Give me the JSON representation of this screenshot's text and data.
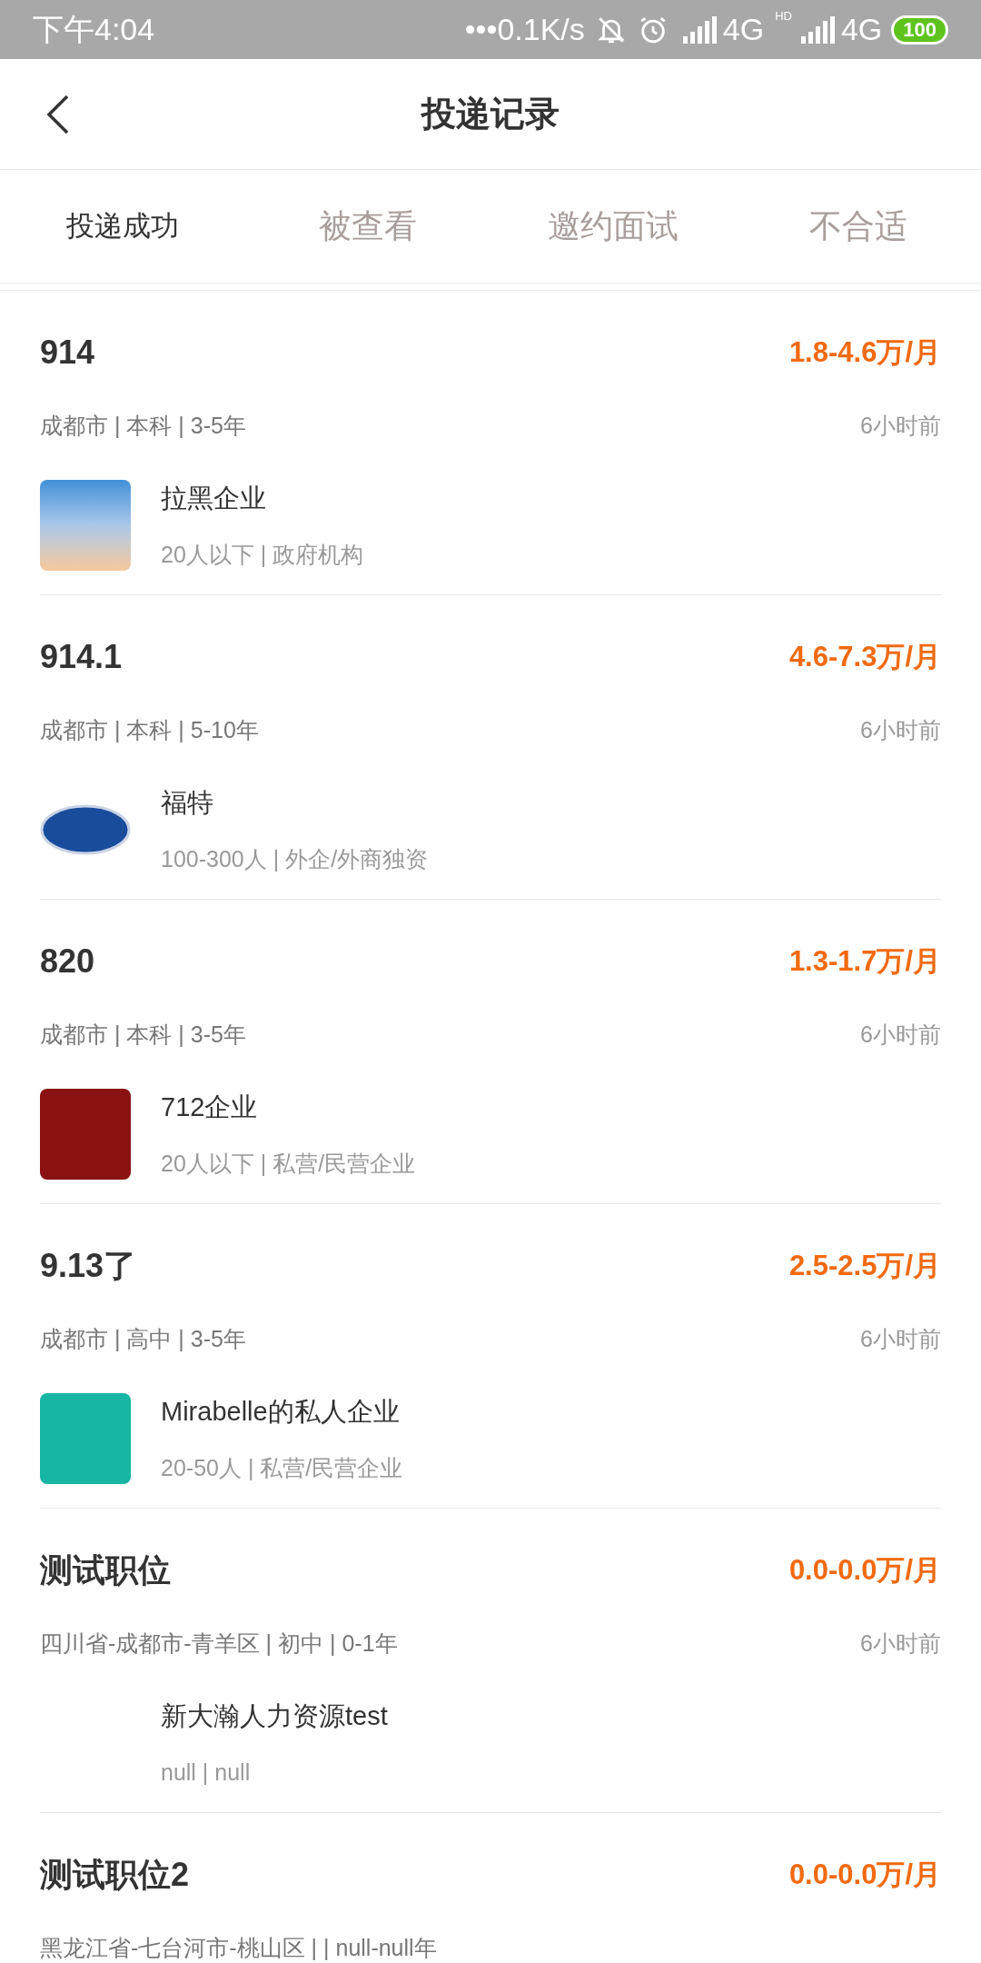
{
  "status_bar": {
    "time": "下午4:04",
    "speed": "•••0.1K/s",
    "network_1": "4G",
    "hd": "HD",
    "network_2": "4G",
    "battery": "100"
  },
  "header": {
    "title": "投递记录"
  },
  "tabs": [
    {
      "label": "投递成功",
      "selected": true
    },
    {
      "label": "被查看",
      "selected": false
    },
    {
      "label": "邀约面试",
      "selected": false
    },
    {
      "label": "不合适",
      "selected": false
    }
  ],
  "applications": [
    {
      "title": "914",
      "salary": "1.8-4.6万/月",
      "meta": "成都市 | 本科 | 3-5年",
      "time": "6小时前",
      "company": "拉黑企业",
      "company_info": "20人以下 | 政府机构",
      "logo": {
        "kind": "photo"
      }
    },
    {
      "title": "914.1",
      "salary": "4.6-7.3万/月",
      "meta": "成都市 | 本科 | 5-10年",
      "time": "6小时前",
      "company": "福特",
      "company_info": "100-300人 | 外企/外商独资",
      "logo": {
        "kind": "oval"
      }
    },
    {
      "title": "820",
      "salary": "1.3-1.7万/月",
      "meta": "成都市 | 本科 | 3-5年",
      "time": "6小时前",
      "company": "712企业",
      "company_info": "20人以下 | 私营/民营企业",
      "logo": {
        "kind": "red"
      }
    },
    {
      "title": "9.13了",
      "salary": "2.5-2.5万/月",
      "meta": "成都市 | 高中 | 3-5年",
      "time": "6小时前",
      "company": "Mirabelle的私人企业",
      "company_info": "20-50人 | 私营/民营企业",
      "logo": {
        "kind": "teal"
      }
    },
    {
      "title": "测试职位",
      "salary": "0.0-0.0万/月",
      "meta": "四川省-成都市-青羊区 | 初中 | 0-1年",
      "time": "6小时前",
      "company": "新大瀚人力资源test",
      "company_info": "null | null"
    },
    {
      "title": "测试职位2",
      "salary": "0.0-0.0万/月",
      "meta": "黑龙江省-七台河市-桃山区 |  | null-null年"
    }
  ]
}
